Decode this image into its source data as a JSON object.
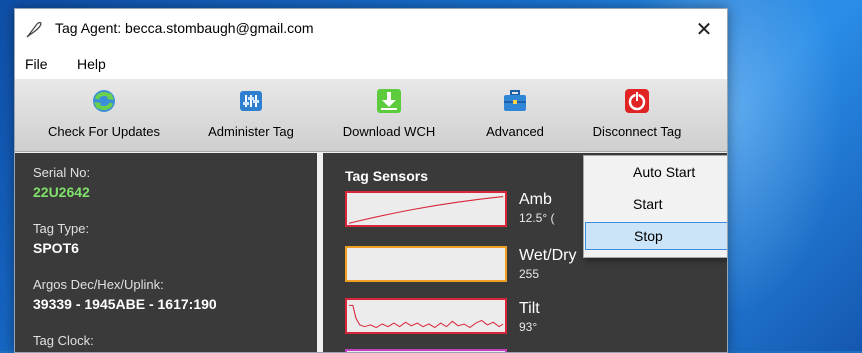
{
  "window": {
    "title": "Tag Agent: becca.stombaugh@gmail.com",
    "close_glyph": "✕"
  },
  "menu": {
    "file": "File",
    "help": "Help"
  },
  "toolbar": {
    "check_updates": "Check For Updates",
    "administer_tag": "Administer Tag",
    "download_wch": "Download WCH",
    "advanced": "Advanced",
    "disconnect_tag": "Disconnect Tag"
  },
  "info": {
    "serial_label": "Serial No:",
    "serial_value": "22U2642",
    "tag_type_label": "Tag Type:",
    "tag_type_value": "SPOT6",
    "argos_label": "Argos Dec/Hex/Uplink:",
    "argos_value": "39339 - 1945ABE - 1617:190",
    "clock_label": "Tag Clock:"
  },
  "sensors": {
    "title": "Tag Sensors",
    "ambient": {
      "name": "Amb",
      "value": "12.5° ("
    },
    "wetdry": {
      "name": "Wet/Dry",
      "value": "255"
    },
    "tilt": {
      "name": "Tilt",
      "value": "93°"
    }
  },
  "dropdown": {
    "auto_start": "Auto Start",
    "start": "Start",
    "stop": "Stop"
  },
  "colors": {
    "panel_bg": "#3a3a3a",
    "serial_green": "#7fe06a",
    "sensor_red": "#d9263a",
    "sensor_orange": "#f0a020",
    "menu_hover": "#cce4f7"
  }
}
